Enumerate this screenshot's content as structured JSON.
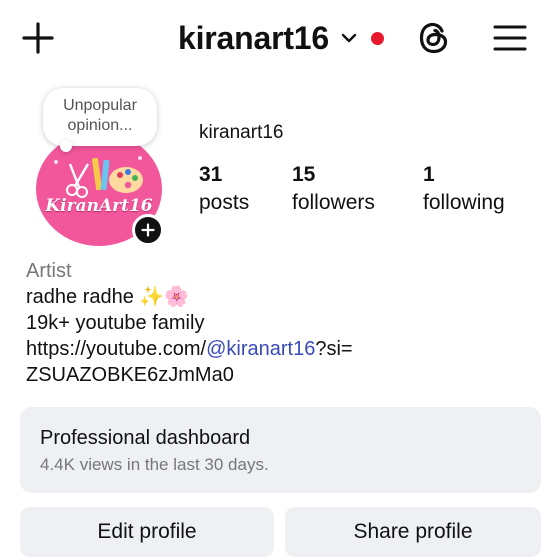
{
  "header": {
    "username": "kiranart16",
    "plus_icon": "plus-icon",
    "dropdown_icon": "chevron-down-icon",
    "notification_dot_color": "#e8192c",
    "threads_icon": "threads-icon",
    "menu_icon": "hamburger-menu-icon"
  },
  "note": {
    "line1": "Unpopular",
    "line2": "opinion..."
  },
  "avatar": {
    "text": "KiranArt16",
    "background_color": "#f2579b",
    "add_story_icon": "plus-icon"
  },
  "profile": {
    "username": "kiranart16",
    "stats": [
      {
        "count": "31",
        "label": "posts"
      },
      {
        "count": "15",
        "label": "followers"
      },
      {
        "count": "1",
        "label": "following"
      }
    ]
  },
  "bio": {
    "category": "Artist",
    "line1": "radhe radhe ✨🌸",
    "line2": "19k+ youtube family",
    "link_prefix": "https://youtube.com/",
    "link_mention": "@kiranart16",
    "link_suffix": "?si=",
    "link_line2": "ZSUAZOBKE6zJmMa0"
  },
  "dashboard": {
    "title": "Professional dashboard",
    "subtitle": "4.4K views in the last 30 days."
  },
  "buttons": {
    "edit": "Edit profile",
    "share": "Share profile"
  }
}
